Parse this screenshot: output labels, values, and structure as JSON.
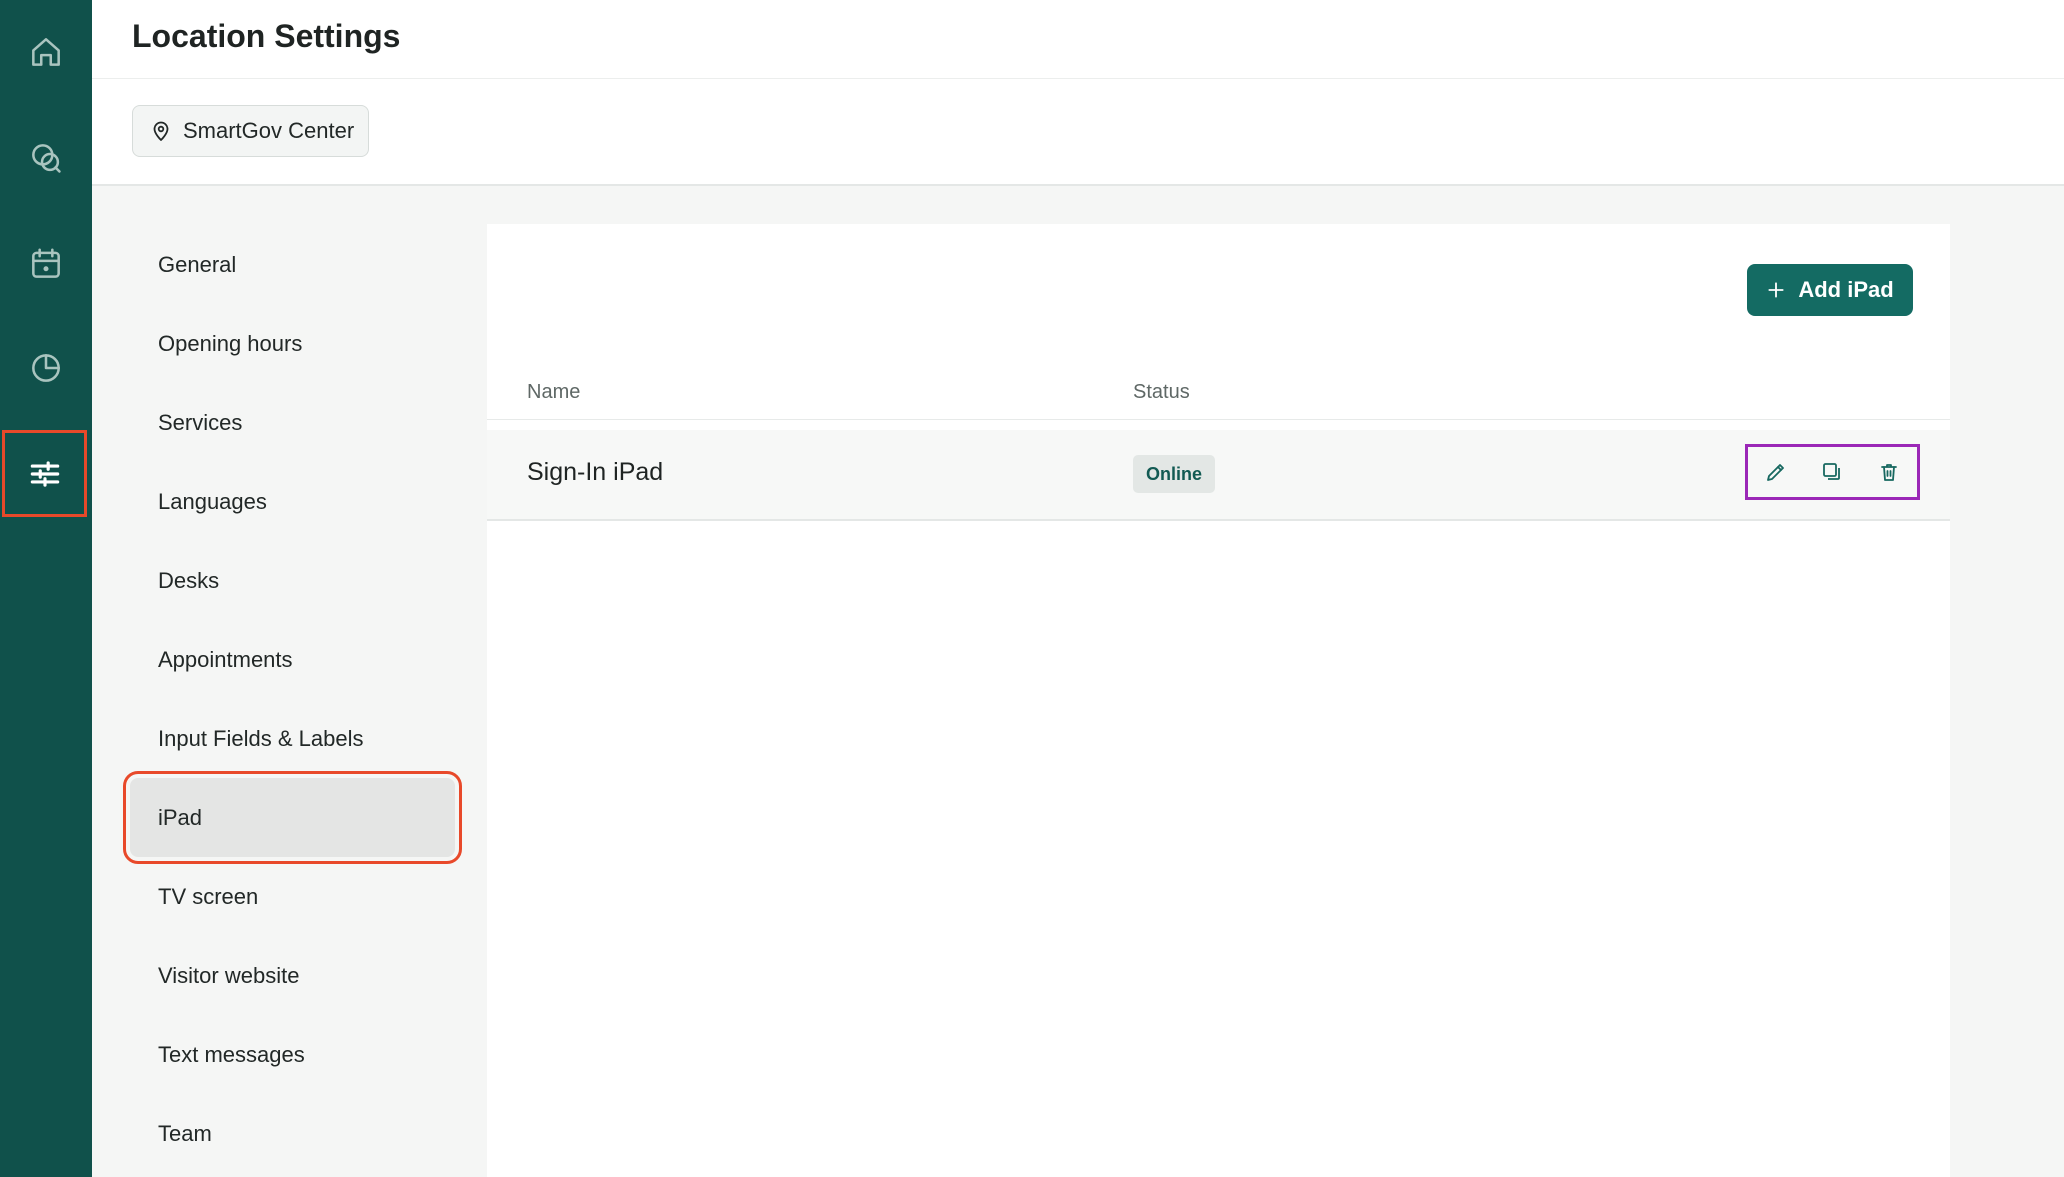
{
  "rail": {
    "items": [
      {
        "icon": "home-icon",
        "name": "rail-home"
      },
      {
        "icon": "chat-icon",
        "name": "rail-messages"
      },
      {
        "icon": "calendar-icon",
        "name": "rail-calendar"
      },
      {
        "icon": "pie-chart-icon",
        "name": "rail-statistics"
      },
      {
        "icon": "sliders-icon",
        "name": "rail-settings",
        "active": true
      }
    ]
  },
  "header": {
    "title": "Location Settings",
    "location_chip": {
      "icon": "map-pin-icon",
      "label": "SmartGov Center"
    }
  },
  "settings_nav": {
    "items": [
      {
        "label": "General"
      },
      {
        "label": "Opening hours"
      },
      {
        "label": "Services"
      },
      {
        "label": "Languages"
      },
      {
        "label": "Desks"
      },
      {
        "label": "Appointments"
      },
      {
        "label": "Input Fields & Labels"
      },
      {
        "label": "iPad",
        "active": true
      },
      {
        "label": "TV screen"
      },
      {
        "label": "Visitor website"
      },
      {
        "label": "Text messages"
      },
      {
        "label": "Team"
      }
    ]
  },
  "main": {
    "add_button": {
      "label": "Add iPad",
      "icon": "plus-icon"
    },
    "table": {
      "columns": [
        "Name",
        "Status"
      ],
      "rows": [
        {
          "name": "Sign-In iPad",
          "status": "Online",
          "actions": [
            "edit-icon",
            "duplicate-icon",
            "trash-icon"
          ]
        }
      ]
    }
  },
  "colors": {
    "rail_bg": "#10514b",
    "accent": "#146b63",
    "highlight_orange": "#e8492a",
    "highlight_purple": "#9b28b7"
  }
}
